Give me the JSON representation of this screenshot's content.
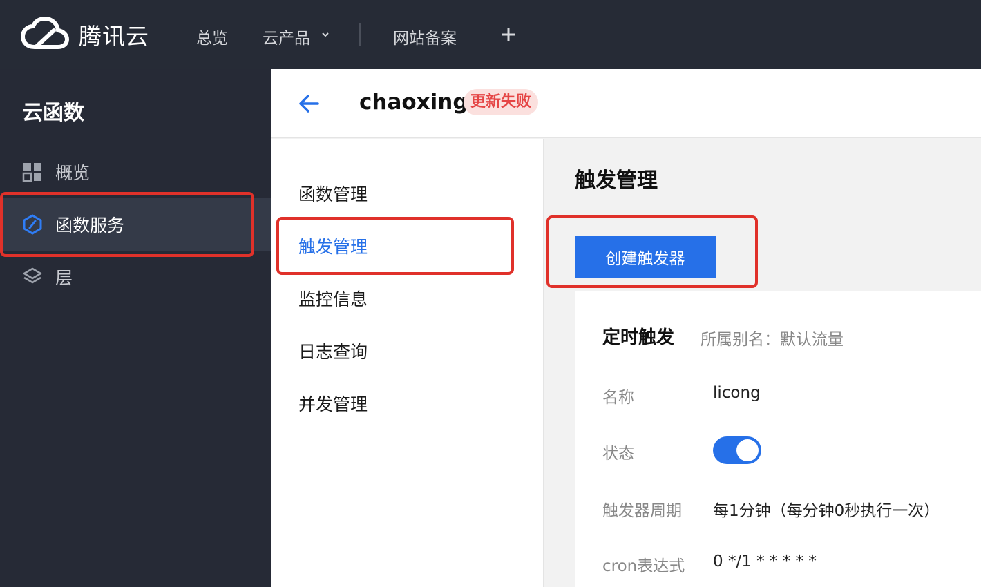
{
  "topbar": {
    "brand": "腾讯云",
    "nav": [
      "总览",
      "云产品",
      "网站备案"
    ]
  },
  "sidebar": {
    "title": "云函数",
    "items": [
      {
        "label": "概览",
        "icon": "grid-icon"
      },
      {
        "label": "函数服务",
        "icon": "function-icon"
      },
      {
        "label": "层",
        "icon": "layers-icon"
      }
    ]
  },
  "header": {
    "function_name": "chaoxing",
    "status_badge": "更新失败"
  },
  "submenu": {
    "items": [
      "函数管理",
      "触发管理",
      "监控信息",
      "日志查询",
      "并发管理"
    ],
    "active": "触发管理"
  },
  "main": {
    "title": "触发管理",
    "create_button": "创建触发器",
    "trigger_card": {
      "title": "定时触发",
      "alias": "所属别名：默认流量",
      "fields": [
        {
          "label": "名称",
          "value": "licong"
        },
        {
          "label": "状态",
          "value": ""
        },
        {
          "label": "触发器周期",
          "value": "每1分钟（每分钟0秒执行一次）"
        },
        {
          "label": "cron表达式",
          "value": "0 */1 * * * * *"
        }
      ],
      "status_enabled": true
    }
  },
  "colors": {
    "accent": "#2670e8",
    "topbar_bg": "#262b36",
    "sidebar_bg": "#262a36",
    "highlight_red": "#e0312a",
    "fail_text": "#e54545"
  }
}
